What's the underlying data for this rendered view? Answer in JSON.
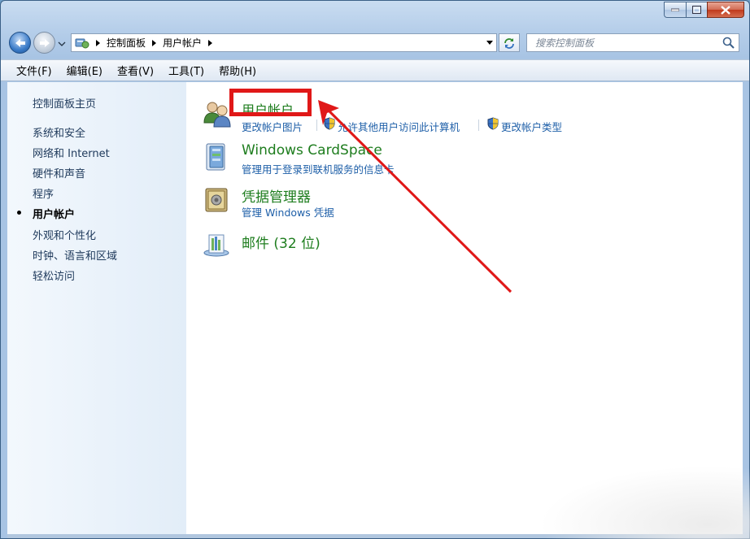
{
  "window": {
    "address": {
      "crumbs": [
        "控制面板",
        "用户帐户"
      ]
    },
    "search": {
      "placeholder": "搜索控制面板"
    }
  },
  "menu": [
    "文件(F)",
    "编辑(E)",
    "查看(V)",
    "工具(T)",
    "帮助(H)"
  ],
  "sidebar": {
    "home": "控制面板主页",
    "items": [
      {
        "label": "系统和安全",
        "active": false
      },
      {
        "label": "网络和 Internet",
        "active": false
      },
      {
        "label": "硬件和声音",
        "active": false
      },
      {
        "label": "程序",
        "active": false
      },
      {
        "label": "用户帐户",
        "active": true
      },
      {
        "label": "外观和个性化",
        "active": false
      },
      {
        "label": "时钟、语言和区域",
        "active": false
      },
      {
        "label": "轻松访问",
        "active": false
      }
    ]
  },
  "categories": {
    "user_accounts": {
      "title": "用户帐户",
      "links": [
        "更改帐户图片",
        "允许其他用户访问此计算机",
        "更改帐户类型"
      ]
    },
    "cardspace": {
      "title": "Windows CardSpace",
      "link": "管理用于登录到联机服务的信息卡"
    },
    "credential": {
      "title": "凭据管理器",
      "link": "管理 Windows 凭据"
    },
    "mail": {
      "title": "邮件 (32 位)"
    }
  },
  "colors": {
    "category_title": "#1e7d1e",
    "link": "#1e5fa8",
    "annotation": "#e01818"
  }
}
